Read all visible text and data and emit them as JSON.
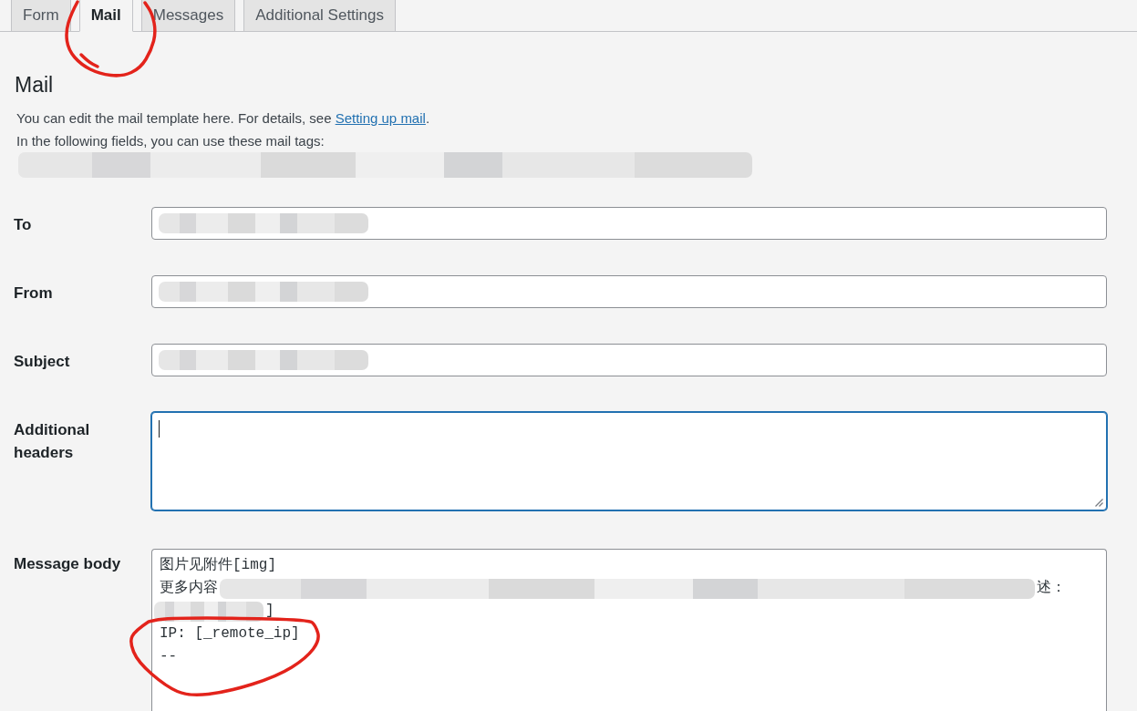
{
  "tabs": [
    {
      "label": "Form",
      "selected": false,
      "circled": false
    },
    {
      "label": "Mail",
      "selected": true,
      "circled": true
    },
    {
      "label": "Messages",
      "selected": false,
      "circled": false
    },
    {
      "label": "Additional Settings",
      "selected": false,
      "circled": false
    }
  ],
  "panel": {
    "title": "Mail",
    "intro": {
      "before": "You can edit the mail template here. For details, see ",
      "link": "Setting up mail",
      "after": "."
    },
    "tags_intro": "In the following fields, you can use these mail tags:",
    "tags_redacted": true
  },
  "fields": [
    {
      "label": "To",
      "kind": "input",
      "redacted": true,
      "focused": false
    },
    {
      "label": "From",
      "kind": "input",
      "redacted": true,
      "focused": false
    },
    {
      "label": "Subject",
      "kind": "input",
      "redacted": true,
      "focused": false
    },
    {
      "label": "Additional headers",
      "kind": "textarea",
      "redacted": false,
      "focused": true
    },
    {
      "label": "Message body",
      "kind": "body",
      "focused": false,
      "lines": [
        {
          "segments": [
            {
              "kind": "text",
              "text": "图片见附件[img]"
            }
          ],
          "circled": false
        },
        {
          "segments": [
            {
              "kind": "text",
              "text": "更多内容"
            },
            {
              "kind": "redacted"
            },
            {
              "kind": "text",
              "text": "述："
            }
          ],
          "circled": false
        },
        {
          "segments": [
            {
              "kind": "redacted"
            },
            {
              "kind": "text",
              "text": "]"
            }
          ],
          "circled": false
        },
        {
          "segments": [
            {
              "kind": "text",
              "text": "IP: [_remote_ip]"
            }
          ],
          "circled": true
        },
        {
          "segments": [
            {
              "kind": "text",
              "text": "--"
            }
          ],
          "circled": true
        }
      ]
    }
  ]
}
